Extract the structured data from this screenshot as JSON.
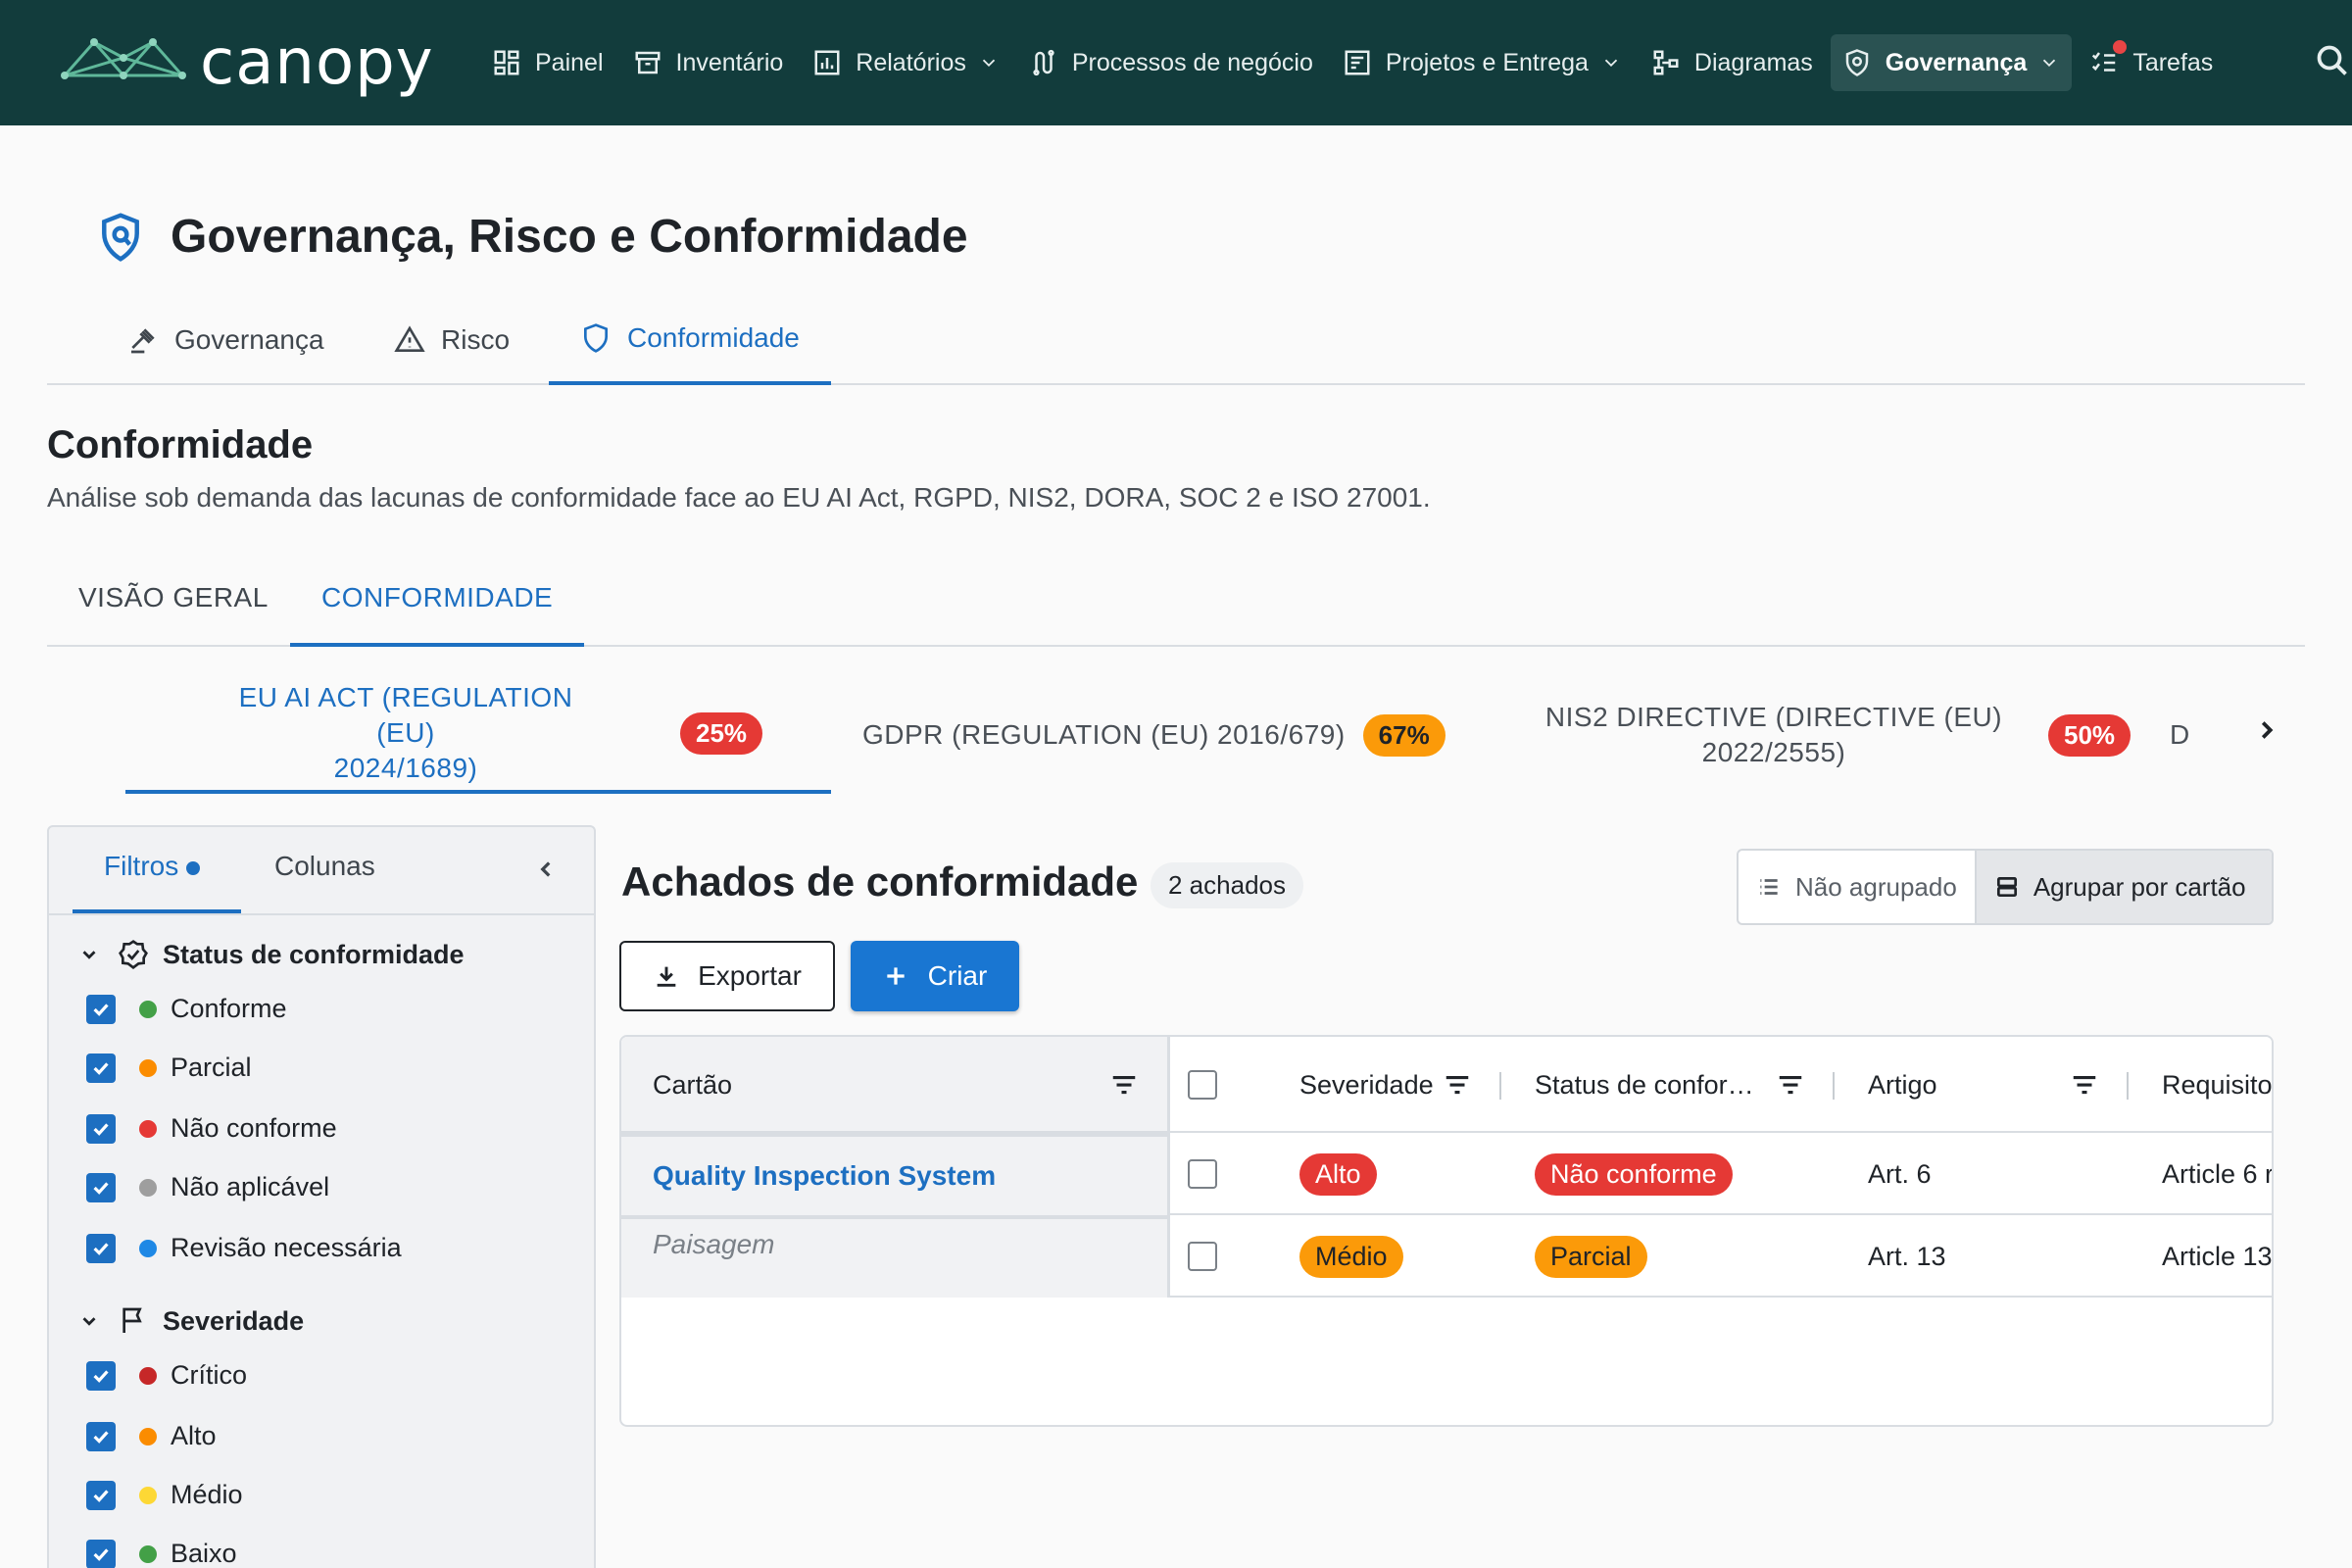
{
  "brand": {
    "name": "canopy"
  },
  "nav": {
    "items": [
      {
        "label": "Painel",
        "icon": "dashboard-icon"
      },
      {
        "label": "Inventário",
        "icon": "archive-icon"
      },
      {
        "label": "Relatórios",
        "icon": "chart-icon",
        "dropdown": true
      },
      {
        "label": "Processos de negócio",
        "icon": "process-icon"
      },
      {
        "label": "Projetos e Entrega",
        "icon": "project-icon",
        "dropdown": true
      },
      {
        "label": "Diagramas",
        "icon": "diagram-icon"
      },
      {
        "label": "Governança",
        "icon": "shield-icon",
        "dropdown": true,
        "active": true
      },
      {
        "label": "Tarefas",
        "icon": "tasks-icon",
        "notification": true
      }
    ]
  },
  "page": {
    "title": "Governança, Risco e Conformidade"
  },
  "grc_tabs": [
    "Governança",
    "Risco",
    "Conformidade"
  ],
  "section": {
    "title": "Conformidade",
    "description": "Análise sob demanda das lacunas de conformidade face ao EU AI Act, RGPD, NIS2, DORA, SOC 2 e ISO 27001."
  },
  "sub_tabs": [
    "VISÃO GERAL",
    "CONFORMIDADE"
  ],
  "frameworks": [
    {
      "label_l1": "EU AI ACT (REGULATION (EU)",
      "label_l2": "2024/1689)",
      "pct": "25%",
      "color": "#e53935"
    },
    {
      "label_l1": "GDPR (REGULATION (EU) 2016/679)",
      "label_l2": "",
      "pct": "67%",
      "color": "#fb9a09"
    },
    {
      "label_l1": "NIS2 DIRECTIVE (DIRECTIVE (EU)",
      "label_l2": "2022/2555)",
      "pct": "50%",
      "color": "#e53935"
    },
    {
      "label_l1": "D",
      "label_l2": "",
      "pct": "",
      "color": ""
    }
  ],
  "filters": {
    "tab_filters": "Filtros",
    "tab_columns": "Colunas",
    "groups": [
      {
        "title": "Status de conformidade",
        "options": [
          {
            "label": "Conforme",
            "color": "#43a047"
          },
          {
            "label": "Parcial",
            "color": "#fb8c00"
          },
          {
            "label": "Não conforme",
            "color": "#e53935"
          },
          {
            "label": "Não aplicável",
            "color": "#9e9e9e"
          },
          {
            "label": "Revisão necessária",
            "color": "#1e88e5"
          }
        ]
      },
      {
        "title": "Severidade",
        "options": [
          {
            "label": "Crítico",
            "color": "#c62828"
          },
          {
            "label": "Alto",
            "color": "#fb8c00"
          },
          {
            "label": "Médio",
            "color": "#fdd835"
          },
          {
            "label": "Baixo",
            "color": "#43a047"
          }
        ]
      }
    ]
  },
  "findings": {
    "title": "Achados de conformidade",
    "count": "2 achados",
    "group_none": "Não agrupado",
    "group_by_card": "Agrupar por cartão",
    "export": "Exportar",
    "create": "Criar",
    "columns": [
      "Cartão",
      "Severidade",
      "Status de confor…",
      "Artigo",
      "Requisito"
    ],
    "rows": [
      {
        "card": "Quality Inspection System",
        "severity": "Alto",
        "severity_color": "#e53935",
        "status": "Não conforme",
        "status_color": "#e53935",
        "article": "Art. 6",
        "requirement": "Article 6 r"
      },
      {
        "card": "Paisagem",
        "severity": "Médio",
        "severity_color": "#fb9a09",
        "status": "Parcial",
        "status_color": "#fb9a09",
        "article": "Art. 13",
        "requirement": "Article 13"
      }
    ]
  }
}
